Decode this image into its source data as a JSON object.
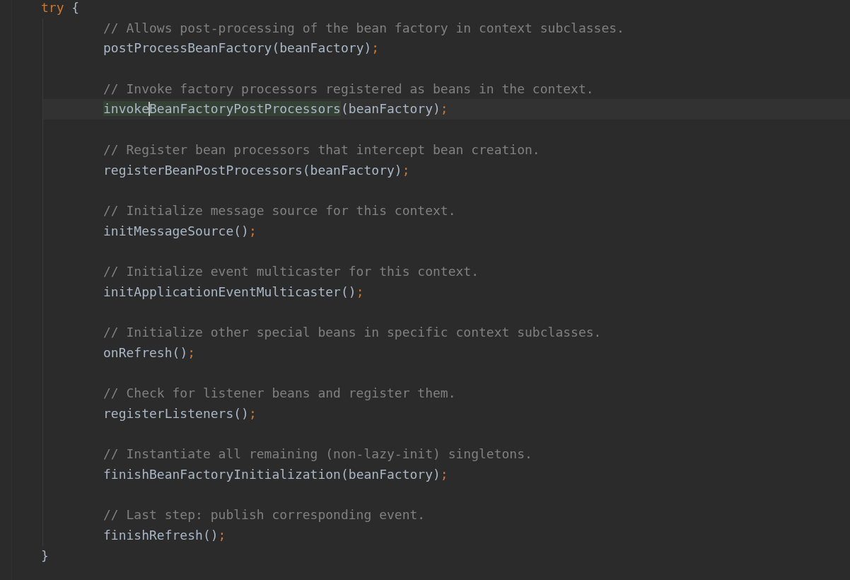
{
  "editor": {
    "block": {
      "keyword": "try",
      "open": "{",
      "close": "}",
      "children": [
        {
          "kind": "comment",
          "text": "// Allows post-processing of the bean factory in context subclasses."
        },
        {
          "kind": "call",
          "name": "postProcessBeanFactory",
          "args": "(beanFactory)",
          "end": ";",
          "current": false
        },
        {
          "kind": "blank"
        },
        {
          "kind": "comment",
          "text": "// Invoke factory processors registered as beans in the context."
        },
        {
          "kind": "call",
          "name": "invoke",
          "name_after_caret": "BeanFactoryPostProcessors",
          "args": "(beanFactory)",
          "end": ";",
          "current": true
        },
        {
          "kind": "blank"
        },
        {
          "kind": "comment",
          "text": "// Register bean processors that intercept bean creation."
        },
        {
          "kind": "call",
          "name": "registerBeanPostProcessors",
          "args": "(beanFactory)",
          "end": ";",
          "current": false
        },
        {
          "kind": "blank"
        },
        {
          "kind": "comment",
          "text": "// Initialize message source for this context."
        },
        {
          "kind": "call",
          "name": "initMessageSource",
          "args": "()",
          "end": ";",
          "current": false
        },
        {
          "kind": "blank"
        },
        {
          "kind": "comment",
          "text": "// Initialize event multicaster for this context."
        },
        {
          "kind": "call",
          "name": "initApplicationEventMulticaster",
          "args": "()",
          "end": ";",
          "current": false
        },
        {
          "kind": "blank"
        },
        {
          "kind": "comment",
          "text": "// Initialize other special beans in specific context subclasses."
        },
        {
          "kind": "call",
          "name": "onRefresh",
          "args": "()",
          "end": ";",
          "current": false
        },
        {
          "kind": "blank"
        },
        {
          "kind": "comment",
          "text": "// Check for listener beans and register them."
        },
        {
          "kind": "call",
          "name": "registerListeners",
          "args": "()",
          "end": ";",
          "current": false
        },
        {
          "kind": "blank"
        },
        {
          "kind": "comment",
          "text": "// Instantiate all remaining (non-lazy-init) singletons."
        },
        {
          "kind": "call",
          "name": "finishBeanFactoryInitialization",
          "args": "(beanFactory)",
          "end": ";",
          "current": false
        },
        {
          "kind": "blank"
        },
        {
          "kind": "comment",
          "text": "// Last step: publish corresponding event."
        },
        {
          "kind": "call",
          "name": "finishRefresh",
          "args": "()",
          "end": ";",
          "current": false
        }
      ]
    }
  }
}
